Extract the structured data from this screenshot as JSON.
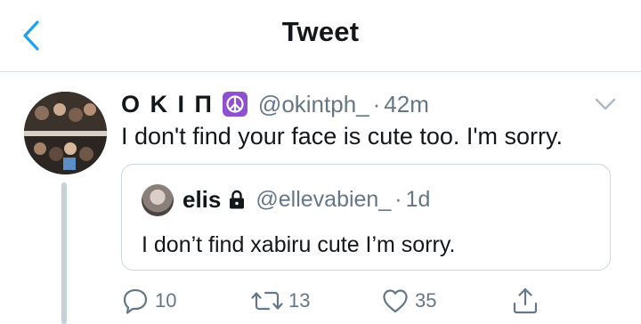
{
  "header": {
    "title": "Tweet"
  },
  "tweet": {
    "author_name": "O K I П",
    "author_handle": "@okintph_",
    "separator": "·",
    "time": "42m",
    "text": "I don't find your face is cute too. I'm sorry.",
    "badge_icon": "peace-sign-icon"
  },
  "quoted_tweet": {
    "author_name": "elis",
    "author_handle": "@ellevabien_",
    "separator": "·",
    "time": "1d",
    "text": "I don’t find xabiru cute I’m sorry.",
    "badge_icon": "lock-icon"
  },
  "actions": {
    "reply_count": "10",
    "retweet_count": "13",
    "like_count": "35"
  },
  "colors": {
    "accent": "#1da1f2",
    "secondary_text": "#657786",
    "badge": "#8e4fd1"
  }
}
